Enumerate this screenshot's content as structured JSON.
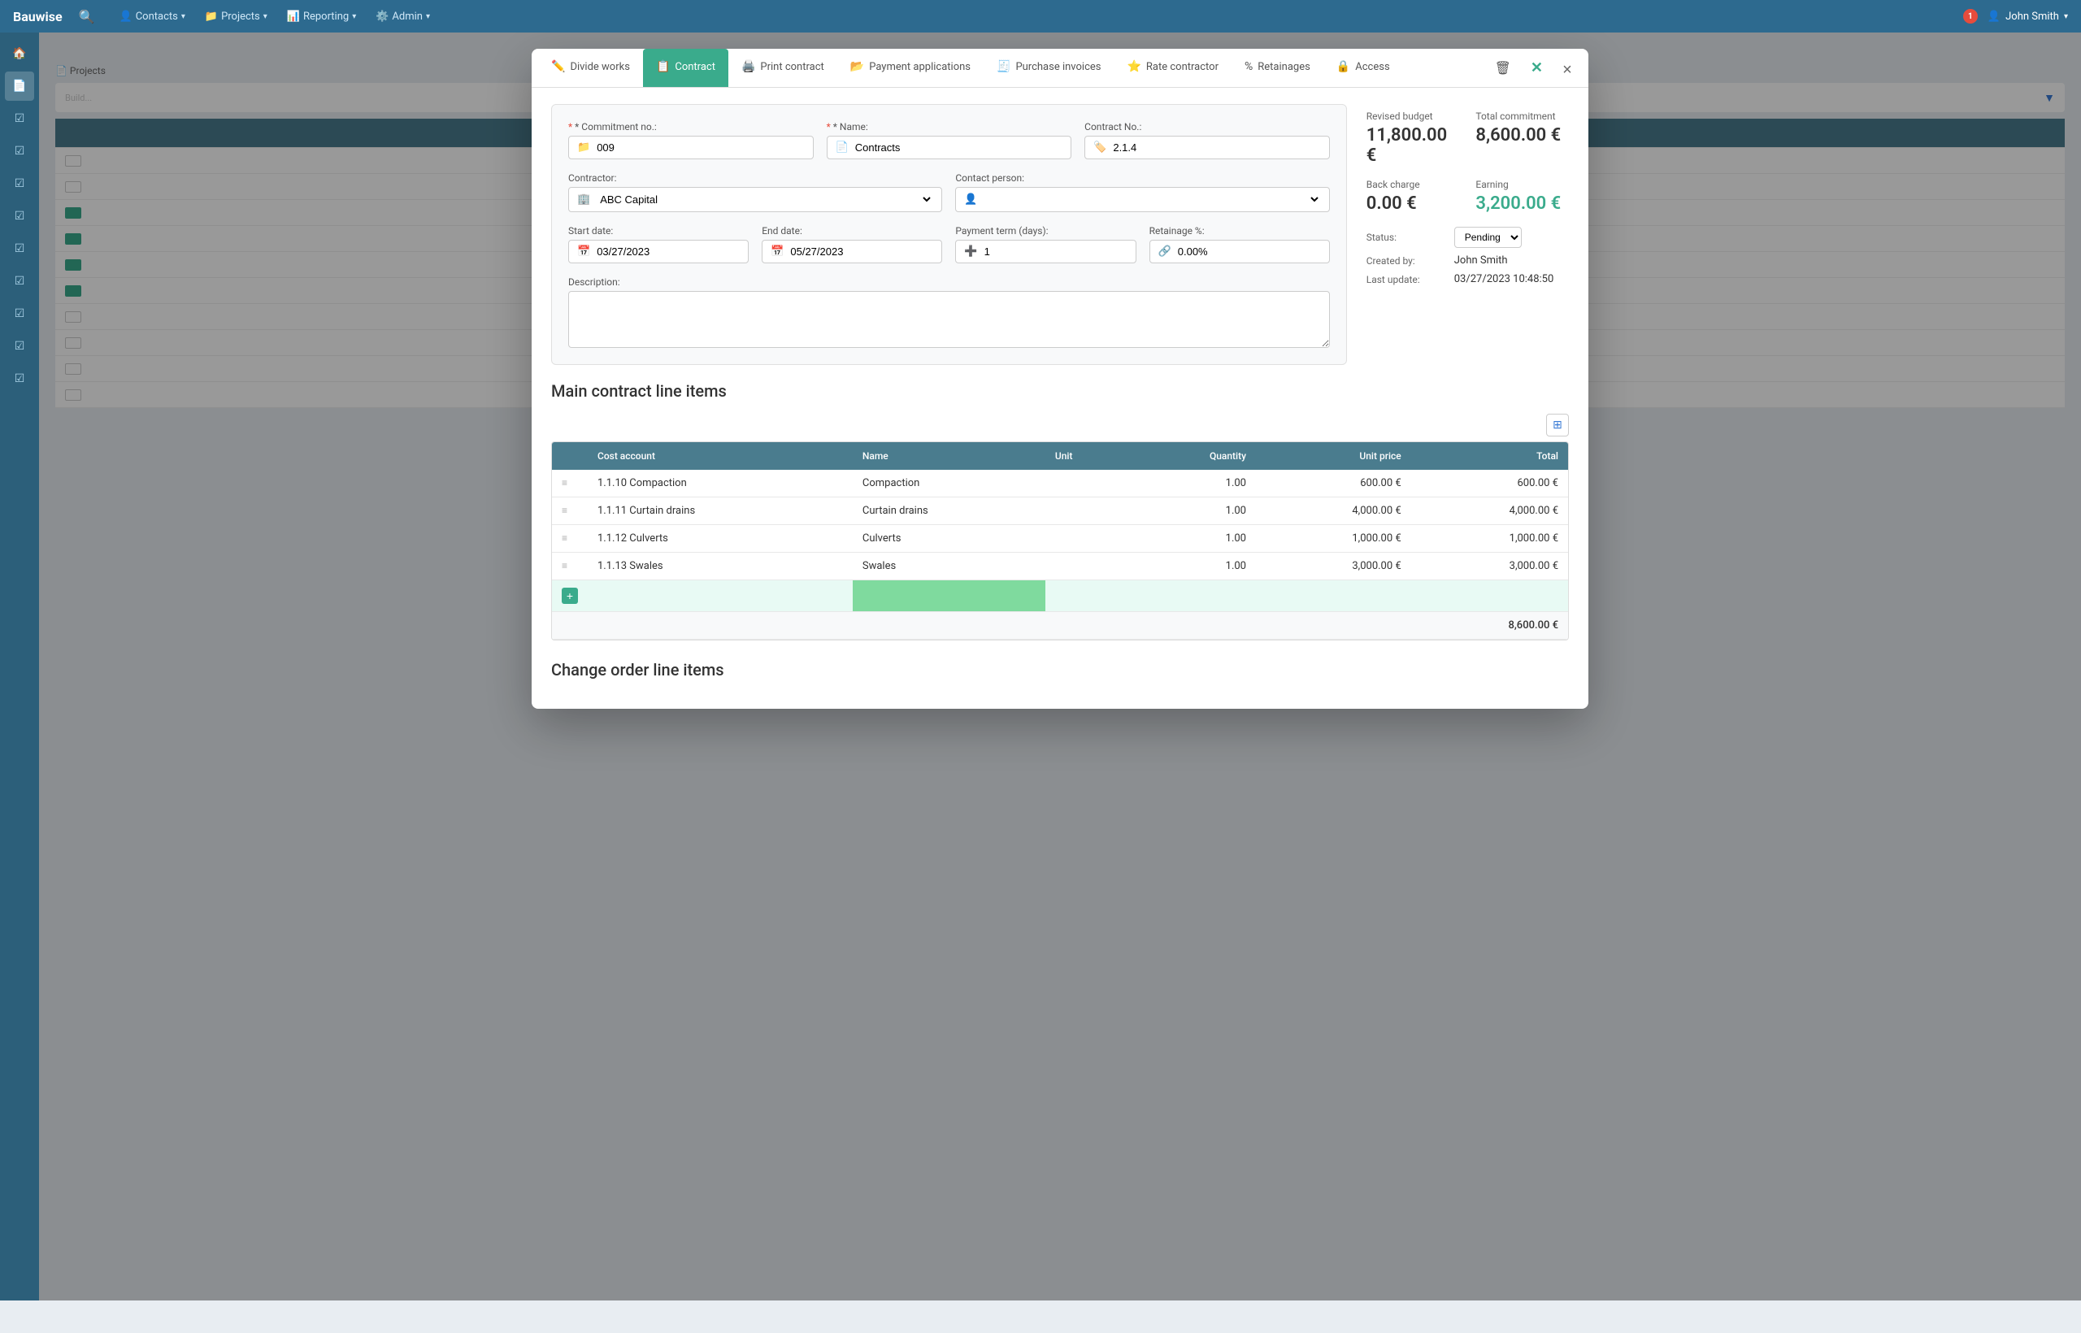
{
  "app": {
    "brand": "Bauwise",
    "user": "John Smith",
    "notif_count": "1"
  },
  "topnav": {
    "items": [
      {
        "label": "Contacts",
        "icon": "👤",
        "id": "contacts"
      },
      {
        "label": "Projects",
        "icon": "📁",
        "id": "projects"
      },
      {
        "label": "Reporting",
        "icon": "📊",
        "id": "reporting"
      },
      {
        "label": "Admin",
        "icon": "⚙️",
        "id": "admin"
      }
    ]
  },
  "tabs": [
    {
      "id": "divide-works",
      "label": "Divide works",
      "icon": "✏️",
      "active": false
    },
    {
      "id": "contract",
      "label": "Contract",
      "icon": "📋",
      "active": true
    },
    {
      "id": "print-contract",
      "label": "Print contract",
      "icon": "🖨️",
      "active": false
    },
    {
      "id": "payment-applications",
      "label": "Payment applications",
      "icon": "📂",
      "active": false
    },
    {
      "id": "purchase-invoices",
      "label": "Purchase invoices",
      "icon": "🧾",
      "active": false
    },
    {
      "id": "rate-contractor",
      "label": "Rate contractor",
      "icon": "⭐",
      "active": false
    },
    {
      "id": "retainages",
      "label": "Retainages",
      "icon": "%",
      "active": false
    },
    {
      "id": "access",
      "label": "Access",
      "icon": "🔒",
      "active": false
    }
  ],
  "form": {
    "commitment_no_label": "* Commitment no.:",
    "commitment_no_value": "009",
    "name_label": "* Name:",
    "name_value": "Contracts",
    "contract_no_label": "Contract No.:",
    "contract_no_value": "2.1.4",
    "contractor_label": "Contractor:",
    "contractor_value": "ABC Capital",
    "contact_person_label": "Contact person:",
    "contact_person_value": "",
    "start_date_label": "Start date:",
    "start_date_value": "03/27/2023",
    "end_date_label": "End date:",
    "end_date_value": "05/27/2023",
    "payment_term_label": "Payment term (days):",
    "payment_term_value": "1",
    "retainage_label": "Retainage %:",
    "retainage_value": "0.00%",
    "description_label": "Description:",
    "description_value": ""
  },
  "stats": {
    "revised_budget_label": "Revised budget",
    "revised_budget_value": "11,800.00 €",
    "total_commitment_label": "Total commitment",
    "total_commitment_value": "8,600.00 €",
    "back_charge_label": "Back charge",
    "back_charge_value": "0.00 €",
    "earning_label": "Earning",
    "earning_value": "3,200.00 €",
    "status_label": "Status:",
    "status_value": "Pending",
    "created_by_label": "Created by:",
    "created_by_value": "John Smith",
    "last_update_label": "Last update:",
    "last_update_value": "03/27/2023 10:48:50"
  },
  "main_table": {
    "title": "Main contract line items",
    "columns": [
      "Cost account",
      "Name",
      "Unit",
      "Quantity",
      "Unit price",
      "Total"
    ],
    "rows": [
      {
        "cost_account": "1.1.10 Compaction",
        "name": "Compaction",
        "unit": "",
        "quantity": "1.00",
        "unit_price": "600.00 €",
        "total": "600.00 €"
      },
      {
        "cost_account": "1.1.11 Curtain drains",
        "name": "Curtain drains",
        "unit": "",
        "quantity": "1.00",
        "unit_price": "4,000.00 €",
        "total": "4,000.00 €"
      },
      {
        "cost_account": "1.1.12 Culverts",
        "name": "Culverts",
        "unit": "",
        "quantity": "1.00",
        "unit_price": "1,000.00 €",
        "total": "1,000.00 €"
      },
      {
        "cost_account": "1.1.13 Swales",
        "name": "Swales",
        "unit": "",
        "quantity": "1.00",
        "unit_price": "3,000.00 €",
        "total": "3,000.00 €"
      }
    ],
    "grand_total": "8,600.00 €"
  },
  "change_order": {
    "title": "Change order line items"
  },
  "buttons": {
    "close_label": "×",
    "delete_label": "🗑",
    "close_x_label": "✕",
    "add_row_label": "+"
  }
}
